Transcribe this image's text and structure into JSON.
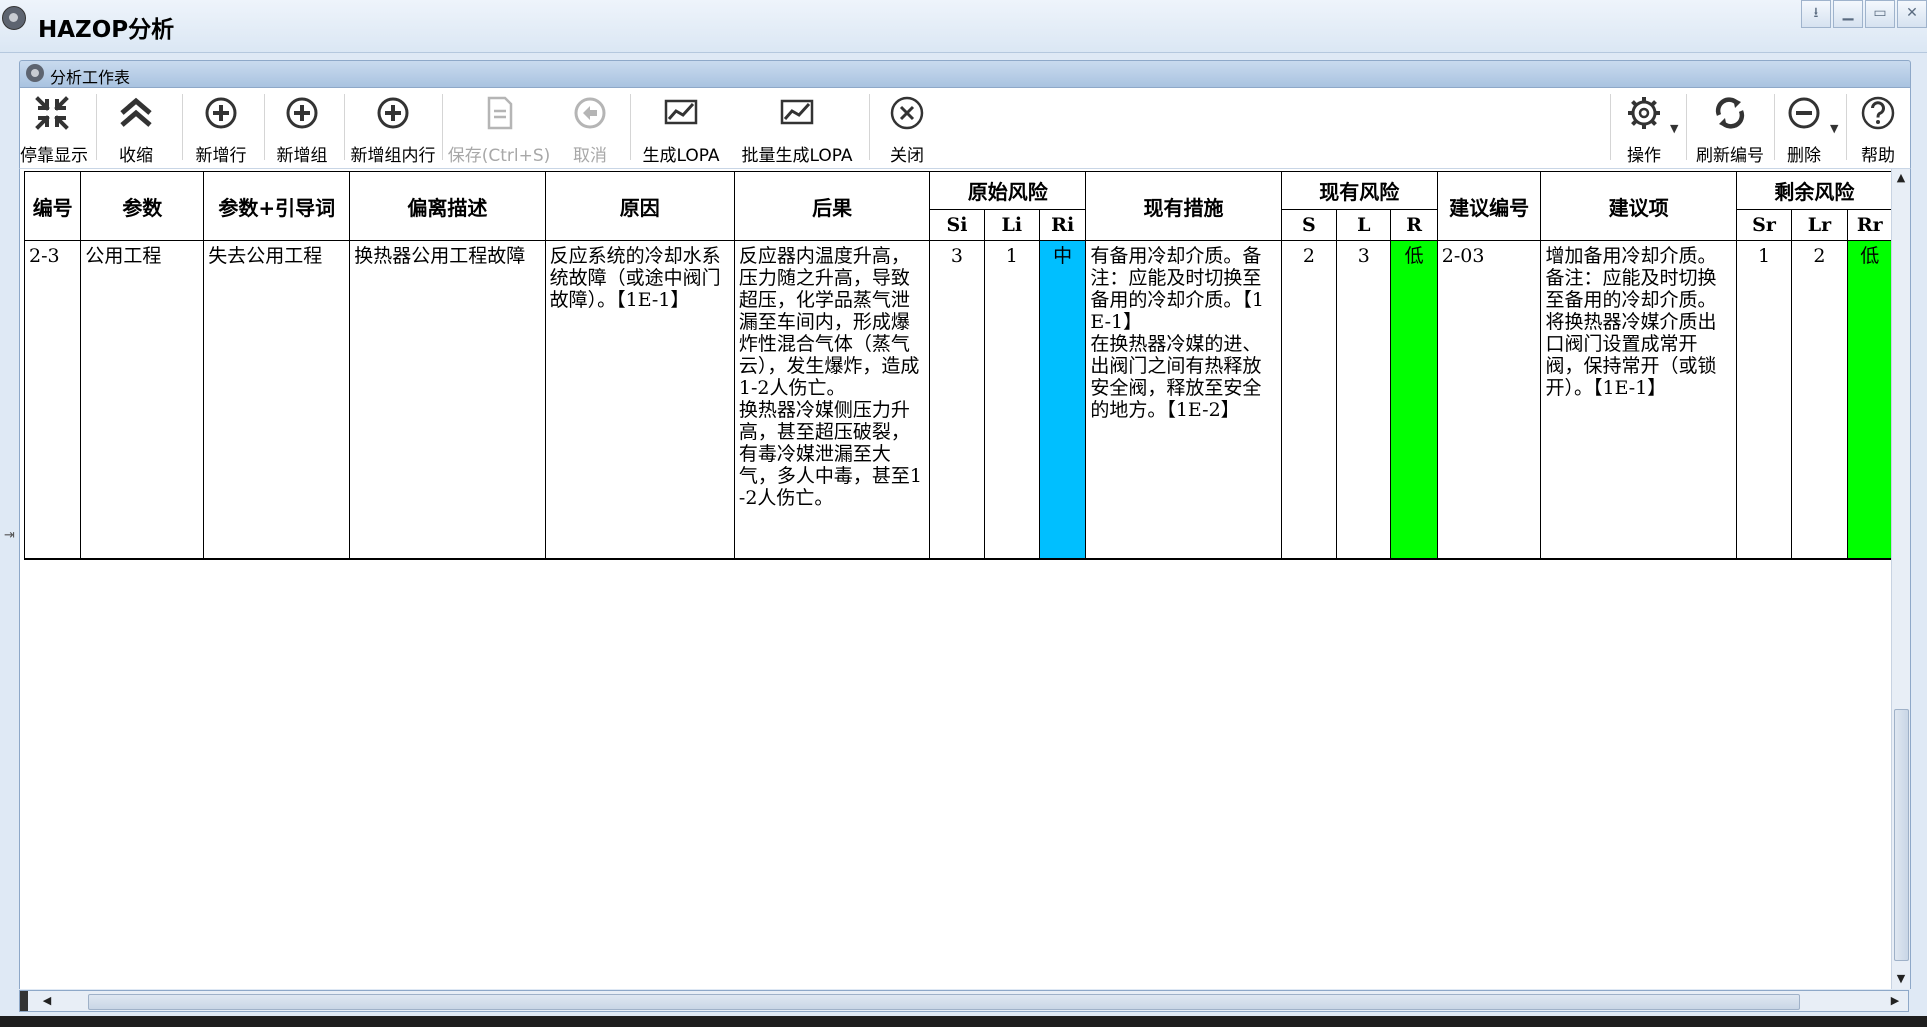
{
  "window": {
    "title": "HAZOP分析",
    "controls": [
      "⭳",
      "▁",
      "▭",
      "✕"
    ]
  },
  "panel": {
    "title": "分析工作表"
  },
  "toolbar": {
    "dock": "停靠显示",
    "collapse": "收缩",
    "add_row": "新增行",
    "add_group": "新增组",
    "add_group_row": "新增组内行",
    "save": "保存(Ctrl+S)",
    "cancel": "取消",
    "gen_lopa": "生成LOPA",
    "batch_lopa": "批量生成LOPA",
    "close": "关闭",
    "operate": "操作",
    "refresh_numbering": "刷新编号",
    "delete": "删除",
    "help": "帮助"
  },
  "grid": {
    "headers": {
      "no": "编号",
      "param": "参数",
      "param_guide": "参数+引导词",
      "deviation": "偏离描述",
      "cause": "原因",
      "consequence": "后果",
      "orig_risk": "原始风险",
      "measures": "现有措施",
      "curr_risk": "现有风险",
      "rec_no": "建议编号",
      "rec": "建议项",
      "residual_risk": "剩余风险",
      "si": "Si",
      "li": "Li",
      "ri": "Ri",
      "s": "S",
      "l": "L",
      "r": "R",
      "sr": "Sr",
      "lr": "Lr",
      "rr": "Rr"
    },
    "rows": [
      {
        "no": "2-3",
        "param": "公用工程",
        "param_guide": "失去公用工程",
        "deviation": "换热器公用工程故障",
        "cause": "反应系统的冷却水系统故障（或途中阀门故障）。【1E-1】",
        "consequence": "反应器内温度升高，压力随之升高，导致超压，化学品蒸气泄漏至车间内，形成爆炸性混合气体（蒸气云），发生爆炸，造成1-2人伤亡。\n换热器冷媒侧压力升高，甚至超压破裂，有毒冷媒泄漏至大气，多人中毒，甚至1-2人伤亡。",
        "si": "3",
        "li": "1",
        "ri": "中",
        "measures": "有备用冷却介质。备注：应能及时切换至备用的冷却介质。【1E-1】\n在换热器冷媒的进、出阀门之间有热释放安全阀，释放至安全的地方。【1E-2】",
        "s": "2",
        "l": "3",
        "r": "低",
        "rec_no": "2-03",
        "rec": "增加备用冷却介质。备注：应能及时切换至备用的冷却介质。\n将换热器冷媒介质出口阀门设置成常开阀，保持常开（或锁开）。【1E-1】",
        "sr": "1",
        "lr": "2",
        "rr": "低"
      }
    ]
  },
  "colors": {
    "risk_medium": "#00bfff",
    "risk_low": "#00ff00"
  }
}
